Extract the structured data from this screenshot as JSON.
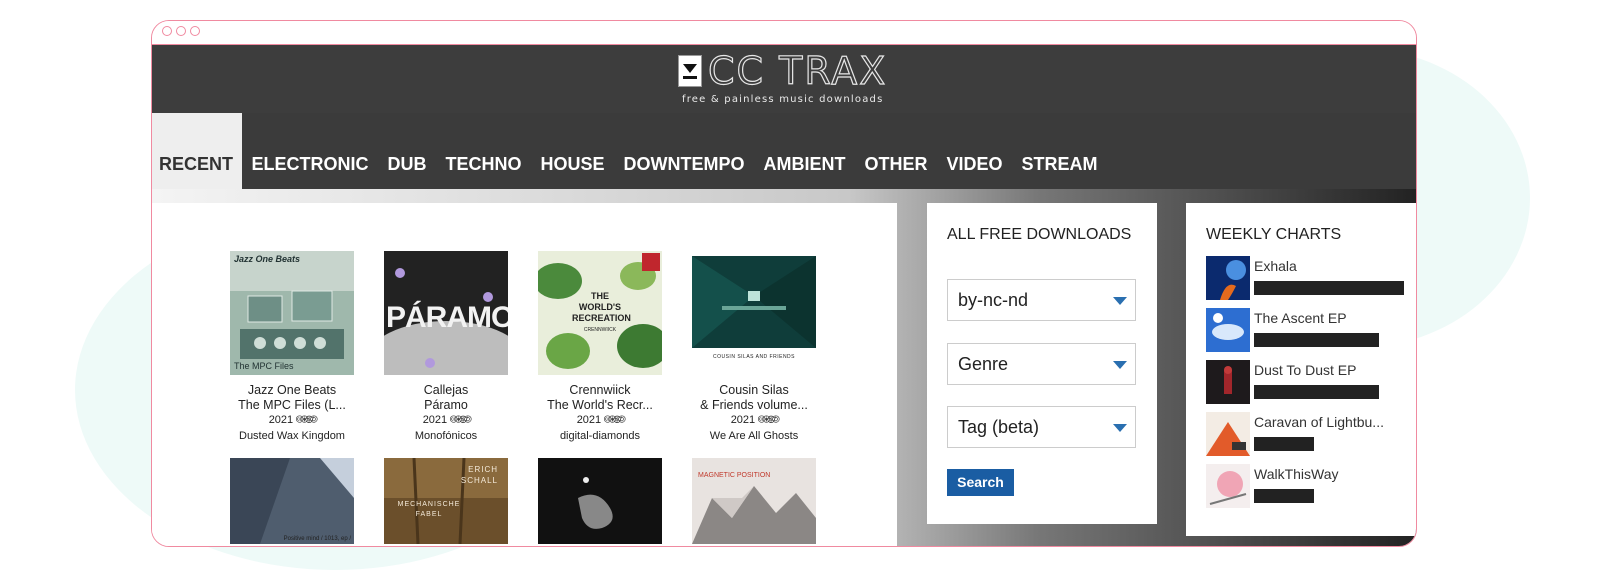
{
  "brand": {
    "logo_text": "CC TRAX",
    "tagline": "free & painless music downloads"
  },
  "nav": {
    "items": [
      "RECENT",
      "ELECTRONIC",
      "DUB",
      "TECHNO",
      "HOUSE",
      "DOWNTEMPO",
      "AMBIENT",
      "OTHER",
      "VIDEO",
      "STREAM"
    ],
    "active": "RECENT"
  },
  "albums": [
    {
      "artist": "Jazz One Beats",
      "title": "The MPC Files (L...",
      "year": "2021",
      "label": "Dusted Wax Kingdom",
      "cover_text": "Jazz One Beats",
      "cover_subtext": "The MPC Files"
    },
    {
      "artist": "Callejas",
      "title": "Páramo",
      "year": "2021",
      "label": "Monofónicos",
      "cover_text": "PÁRAMO"
    },
    {
      "artist": "Crennwiick",
      "title": "The World's Recr...",
      "year": "2021",
      "label": "digital-diamonds",
      "cover_text": "THE WORLD'S RECREATION",
      "cover_subtext": "CRENNWIICK"
    },
    {
      "artist": "Cousin Silas",
      "title": "& Friends volume...",
      "year": "2021",
      "label": "We Are All Ghosts",
      "cover_text": "COUSIN SILAS AND FRIENDS"
    },
    {
      "cover_text": "Positive mind / 1013, ep /"
    },
    {
      "cover_text": "ERICH SCHALL",
      "cover_subtext": "MECHANISCHE FABEL"
    },
    {
      "cover_text": ""
    },
    {
      "cover_text": "MAGNETIC POSITION"
    }
  ],
  "cc_icons": "🅭🅯🄏🄎",
  "downloads_panel": {
    "title": "ALL FREE DOWNLOADS",
    "license_select": "by-nc-nd",
    "genre_select": "Genre",
    "tag_select": "Tag (beta)",
    "search_label": "Search"
  },
  "charts_panel": {
    "title": "WEEKLY CHARTS",
    "items": [
      {
        "name": "Exhala",
        "bar_fraction": 1.0
      },
      {
        "name": "The Ascent EP",
        "bar_fraction": 0.83
      },
      {
        "name": "Dust To Dust EP",
        "bar_fraction": 0.83
      },
      {
        "name": "Caravan of Lightbu...",
        "bar_fraction": 0.4
      },
      {
        "name": "WalkThisWay",
        "bar_fraction": 0.4
      }
    ]
  },
  "colors": {
    "accent_blue": "#1a5da3",
    "header_bg": "#3d3d3d",
    "window_border": "#f08aa0"
  }
}
